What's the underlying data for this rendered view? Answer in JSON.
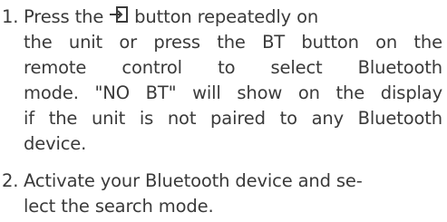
{
  "steps": [
    {
      "number": "1.",
      "lines": {
        "l1a": "Press the",
        "l1b": "button repeatedly on",
        "l2": "the unit or press the BT button on the",
        "l3": "remote control to select Bluetooth",
        "l4": "mode. \"NO BT\" will show on the display",
        "l5": "if the unit is not paired to any Bluetooth",
        "l6": "device."
      },
      "icon": "source-input-icon"
    },
    {
      "number": "2.",
      "lines": {
        "l1": "Activate your Bluetooth device and se-",
        "l2": "lect the search mode."
      }
    }
  ]
}
